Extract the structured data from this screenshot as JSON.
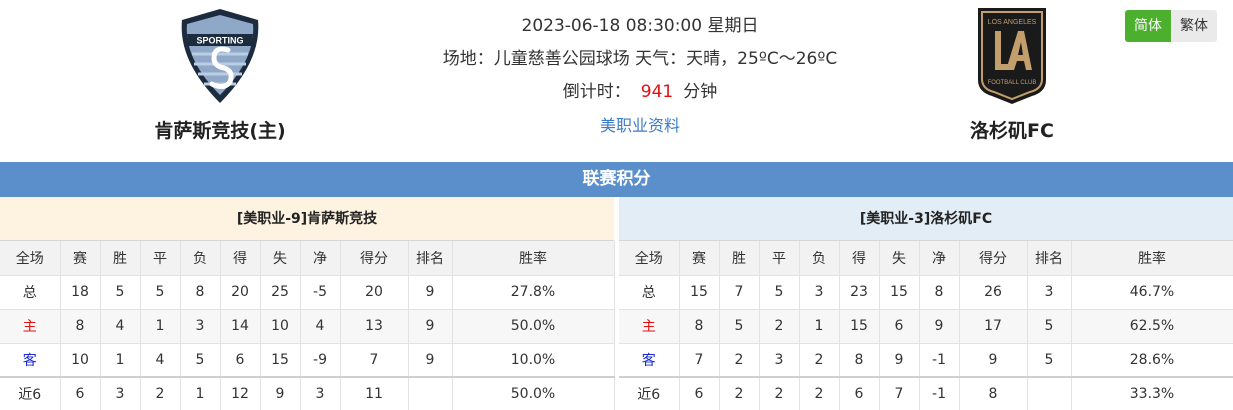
{
  "match": {
    "datetime": "2023-06-18 08:30:00 星期日",
    "venue_weather": "场地：儿童慈善公园球场 天气：天晴，25ºC～26ºC",
    "countdown_label": "倒计时：",
    "countdown_value": "941",
    "countdown_unit": "分钟",
    "league_link": "美职业资料"
  },
  "home_team": {
    "name": "肯萨斯竞技(主)",
    "logo_icon": "sporting-kc-crest-icon",
    "logo_text": "SPORTING"
  },
  "away_team": {
    "name": "洛杉矶FC",
    "logo_icon": "lafc-crest-icon",
    "logo_text_top": "LOS ANGELES",
    "logo_text_bottom": "FOOTBALL CLUB"
  },
  "lang": {
    "simplified": "简体",
    "traditional": "繁体"
  },
  "standings": {
    "title": "联赛积分",
    "columns": [
      "全场",
      "赛",
      "胜",
      "平",
      "负",
      "得",
      "失",
      "净",
      "得分",
      "排名",
      "胜率"
    ],
    "home": {
      "title": "[美职业-9]肯萨斯竞技",
      "rows": [
        [
          "总",
          "18",
          "5",
          "5",
          "8",
          "20",
          "25",
          "-5",
          "20",
          "9",
          "27.8%"
        ],
        [
          "主",
          "8",
          "4",
          "1",
          "3",
          "14",
          "10",
          "4",
          "13",
          "9",
          "50.0%"
        ],
        [
          "客",
          "10",
          "1",
          "4",
          "5",
          "6",
          "15",
          "-9",
          "7",
          "9",
          "10.0%"
        ],
        [
          "近6",
          "6",
          "3",
          "2",
          "1",
          "12",
          "9",
          "3",
          "11",
          "",
          "50.0%"
        ]
      ]
    },
    "away": {
      "title": "[美职业-3]洛杉矶FC",
      "rows": [
        [
          "总",
          "15",
          "7",
          "5",
          "3",
          "23",
          "15",
          "8",
          "26",
          "3",
          "46.7%"
        ],
        [
          "主",
          "8",
          "5",
          "2",
          "1",
          "15",
          "6",
          "9",
          "17",
          "5",
          "62.5%"
        ],
        [
          "客",
          "7",
          "2",
          "3",
          "2",
          "8",
          "9",
          "-1",
          "9",
          "5",
          "28.6%"
        ],
        [
          "近6",
          "6",
          "2",
          "2",
          "2",
          "6",
          "7",
          "-1",
          "8",
          "",
          "33.3%"
        ]
      ]
    }
  },
  "colors": {
    "accent_blue": "#5b8fcb",
    "home_label": "#e01010",
    "away_label": "#1a2ad0",
    "lang_active": "#4caf2e"
  }
}
